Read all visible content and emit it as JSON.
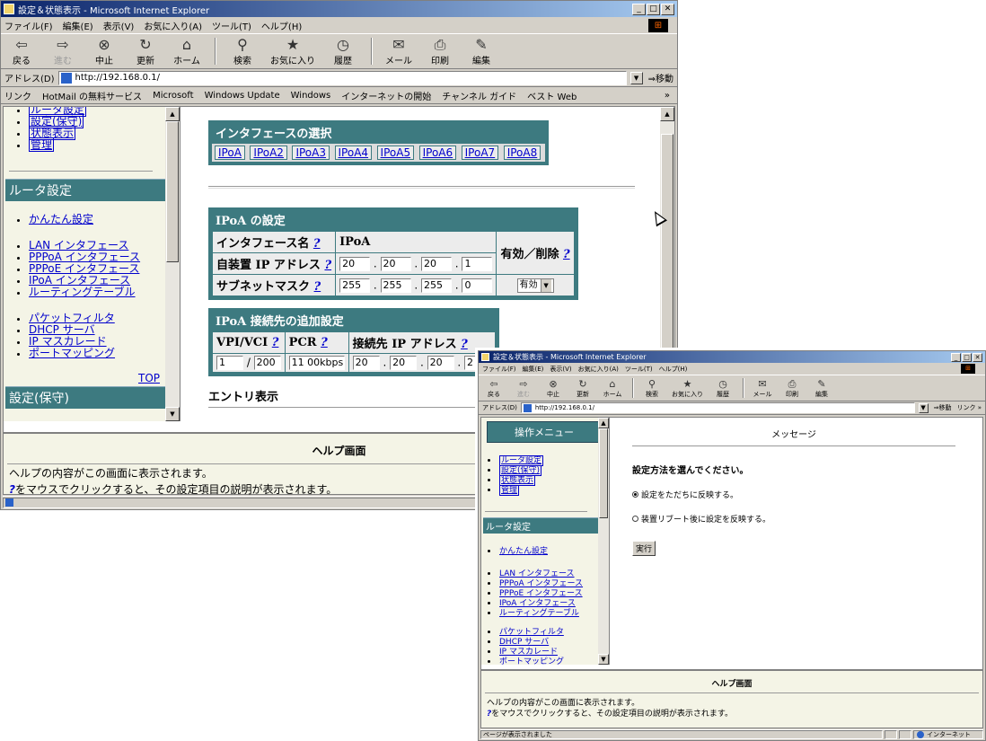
{
  "window1": {
    "title": "設定＆状態表示 - Microsoft Internet Explorer",
    "menu": [
      "ファイル(F)",
      "編集(E)",
      "表示(V)",
      "お気に入り(A)",
      "ツール(T)",
      "ヘルプ(H)"
    ],
    "toolbar": {
      "back": "戻る",
      "forward": "進む",
      "stop": "中止",
      "refresh": "更新",
      "home": "ホーム",
      "search": "検索",
      "favorites": "お気に入り",
      "history": "履歴",
      "mail": "メール",
      "print": "印刷",
      "edit": "編集"
    },
    "address_label": "アドレス(D)",
    "address": "http://192.168.0.1/",
    "go_label": "移動",
    "links_label": "リンク",
    "links": [
      "HotMail の無料サービス",
      "Microsoft",
      "Windows Update",
      "Windows",
      "インターネットの開始",
      "チャンネル ガイド",
      "ベスト Web"
    ],
    "nav": {
      "top_items": [
        "ルータ設定",
        "設定(保守)",
        "状態表示",
        "管理"
      ],
      "section_router": "ルータ設定",
      "easy_setup": "かんたん設定",
      "group1": [
        "LAN インタフェース",
        "PPPoA インタフェース",
        "PPPoE インタフェース",
        "IPoA インタフェース",
        "ルーティングテーブル"
      ],
      "group2": [
        "パケットフィルタ",
        "DHCP サーバ",
        "IP マスカレード",
        "ポートマッピング"
      ],
      "top_link": "TOP",
      "section_maint": "設定(保守)"
    },
    "iface_select": {
      "title": "インタフェースの選択",
      "items": [
        "IPoA",
        "IPoA2",
        "IPoA3",
        "IPoA4",
        "IPoA5",
        "IPoA6",
        "IPoA7",
        "IPoA8"
      ]
    },
    "ipoa": {
      "title": "IPoA の設定",
      "iface_label": "インタフェース名",
      "iface_value": "IPoA",
      "enable_label": "有効／削除",
      "ip_label": "自装置 IP アドレス",
      "ip": [
        "20",
        "20",
        "20",
        "1"
      ],
      "mask_label": "サブネットマスク",
      "mask": [
        "255",
        "255",
        "255",
        "0"
      ],
      "enable_value": "有効",
      "q": "?"
    },
    "conn": {
      "title": "IPoA 接続先の追加設定",
      "vpi_label": "VPI/VCI",
      "pcr_label": "PCR",
      "dest_label": "接続先 IP アドレス",
      "vpi": "1",
      "vci": "200",
      "pcr": "11 00kbps",
      "dest": [
        "20",
        "20",
        "20",
        "2"
      ]
    },
    "entry_label": "エントリ表示",
    "help_title": "ヘルプ画面",
    "help_line1": "ヘルプの内容がこの画面に表示されます。",
    "help_line2": "をマウスでクリックすると、その設定項目の説明が表示されます。"
  },
  "window2": {
    "title": "設定＆状態表示 - Microsoft Internet Explorer",
    "menu": [
      "ファイル(F)",
      "編集(E)",
      "表示(V)",
      "お気に入り(A)",
      "ツール(T)",
      "ヘルプ(H)"
    ],
    "address_label": "アドレス(D)",
    "address": "http://192.168.0.1/",
    "go_label": "移動",
    "links_label": "リンク »",
    "op_menu": "操作メニュー",
    "message_title": "メッセージ",
    "prompt": "設定方法を選んでください。",
    "option1": "設定をただちに反映する。",
    "option2": "装置リブート後に設定を反映する。",
    "exec": "実行",
    "help_title": "ヘルプ画面",
    "help_line1": "ヘルプの内容がこの画面に表示されます。",
    "help_line2": "をマウスでクリックすると、その設定項目の説明が表示されます。",
    "status": "ページが表示されました",
    "zone": "インターネット"
  }
}
